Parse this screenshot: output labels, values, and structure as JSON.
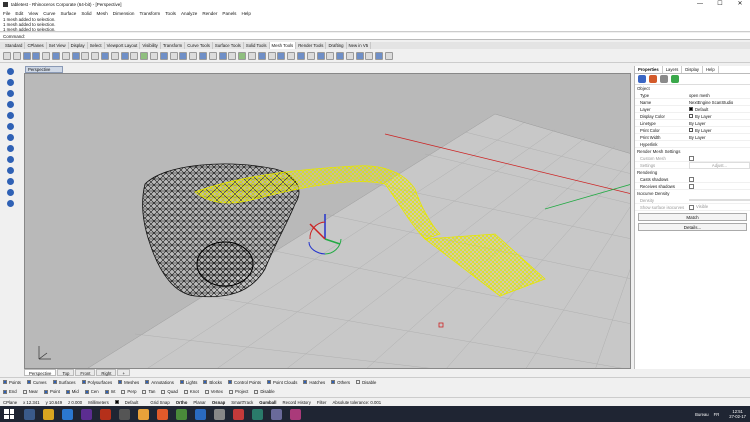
{
  "window": {
    "title": "tabletest - Rhinoceros Corporate (64-bit) - [Perspective]",
    "controls": [
      "—",
      "☐",
      "✕"
    ]
  },
  "menu": [
    "File",
    "Edit",
    "View",
    "Curve",
    "Surface",
    "Solid",
    "Mesh",
    "Dimension",
    "Transform",
    "Tools",
    "Analyze",
    "Render",
    "Panels",
    "Help"
  ],
  "history": [
    "1 mesh added to selection.",
    "1 mesh added to selection.",
    "1 mesh added to selection."
  ],
  "command": {
    "label": "Command:",
    "value": ""
  },
  "toolbar_tabs": [
    "Standard",
    "CPlanes",
    "Set View",
    "Display",
    "Select",
    "Viewport Layout",
    "Visibility",
    "Transform",
    "Curve Tools",
    "Surface Tools",
    "Solid Tools",
    "Mesh Tools",
    "Render Tools",
    "Drafting",
    "New in V5"
  ],
  "active_toolbar_tab": "Mesh Tools",
  "viewport": {
    "label": "Perspective",
    "tabs": [
      "Perspective",
      "Top",
      "Front",
      "Right"
    ],
    "active_tab": "Perspective",
    "add_tab": "+"
  },
  "panel": {
    "tabs": [
      "Properties",
      "Layers",
      "Display",
      "Help"
    ],
    "active_tab": "Properties",
    "section_object": "Object",
    "props": [
      {
        "k": "Type",
        "v": "open mesh"
      },
      {
        "k": "Name",
        "v": "NextEngine ScanStudio"
      },
      {
        "k": "Layer",
        "v": "Default"
      },
      {
        "k": "Display Color",
        "v": "By Layer"
      },
      {
        "k": "Linetype",
        "v": "By Layer"
      },
      {
        "k": "Print Color",
        "v": "By Layer"
      },
      {
        "k": "Print Width",
        "v": "By Layer"
      },
      {
        "k": "Hyperlink",
        "v": ""
      }
    ],
    "section_render": "Render Mesh Settings",
    "custom_mesh": "Custom Mesh",
    "settings_label": "Settings",
    "adjust_label": "Adjust...",
    "section_rendering": "Rendering",
    "casts_shadows": "Casts shadows",
    "receives_shadows": "Receives shadows",
    "section_isocurve": "Isocurve Density",
    "density_label": "Density",
    "show_surface_isocurves": "Show surface isocurves",
    "visible_label": "Visible",
    "match_button": "Match",
    "details_button": "Details..."
  },
  "osnaps_row1": [
    "Points",
    "Curves",
    "Surfaces",
    "Polysurfaces",
    "Meshes",
    "Annotations",
    "Lights",
    "Blocks",
    "Control Points",
    "Point Clouds",
    "Hatches",
    "Others",
    "Disable"
  ],
  "osnaps_row2": [
    "End",
    "Near",
    "Point",
    "Mid",
    "Cen",
    "Int",
    "Perp",
    "Tan",
    "Quad",
    "Knot",
    "Vertex",
    "Project",
    "Disable"
  ],
  "status": {
    "cplane": "CPlane",
    "x": "x 12.341",
    "y": "y 10.649",
    "z": "z 0.000",
    "units": "Millimeters",
    "layer": "Default",
    "toggles": [
      "Grid Snap",
      "Ortho",
      "Planar",
      "Osnap",
      "SmartTrack",
      "Gumball",
      "Record History",
      "Filter"
    ],
    "tolerance": "Absolute tolerance: 0.001"
  },
  "tray": {
    "weather": "Bureau",
    "lang": "FR",
    "time": "12:51",
    "date": "27-02-17"
  },
  "colors": {
    "viewport_bg": "#b9b9b9",
    "selected_mesh": "#ffff33",
    "axis_x": "#cc2222",
    "axis_y": "#22aa44",
    "accent": "#2f61b5"
  }
}
